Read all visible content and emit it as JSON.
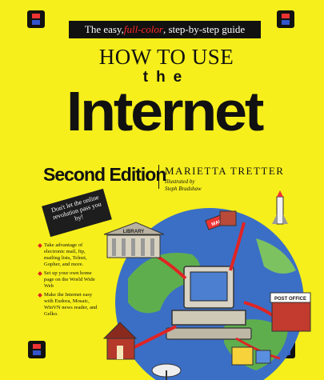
{
  "cover": {
    "tagline_pre": "The easy, ",
    "tagline_highlight": "full-color",
    "tagline_post": ", step-by-step guide",
    "title_line1": "HOW TO USE",
    "title_line2": "the",
    "title_line3": "Internet",
    "edition": "Second Edition",
    "author": "MARIETTA TRETTER",
    "illustrated_by": "Illustrated by",
    "illustrator": "Steph Bradshaw",
    "callout": "Don't let the online revolution pass you by!",
    "bullets": [
      "Take advantage of electronic mail, ftp, mailing lists, Telnet, Gopher, and more.",
      "Set up your own home page on the World Wide Web",
      "Make the Internet easy with Eudora, Mosaic, WinVN news reader, and Gelko."
    ],
    "art_labels": {
      "library": "LIBRARY",
      "mail": "MAIL",
      "post_office": "POST OFFICE"
    },
    "colors": {
      "background": "#f6ef1b",
      "banner": "#111111",
      "accent_red": "#ff2a2a",
      "globe_blue": "#3b6fc6"
    }
  }
}
